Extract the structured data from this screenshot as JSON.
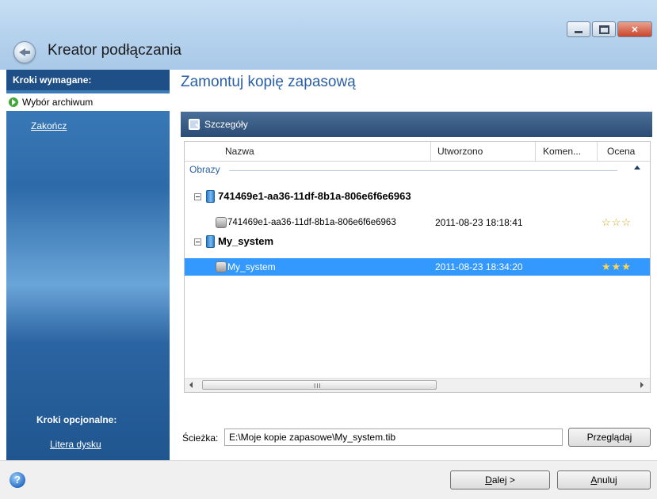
{
  "window": {
    "title": "Kreator podłączania",
    "controls": [
      "minimize-icon",
      "maximize-icon",
      "close-icon"
    ]
  },
  "sidebar": {
    "required_heading": "Kroki wymagane:",
    "steps": [
      {
        "label": "Wybór archiwum",
        "active": true
      },
      {
        "label": "Zakończ",
        "active": false
      }
    ],
    "optional_heading": "Kroki opcjonalne:",
    "optional_steps": [
      {
        "label": "Litera dysku"
      }
    ]
  },
  "main": {
    "title": "Zamontuj kopię zapasową",
    "details_label": "Szczegóły",
    "columns": [
      "Nazwa",
      "Utworzono",
      "Komen...",
      "Ocena"
    ],
    "group_label": "Obrazy",
    "tree": [
      {
        "level": 0,
        "icon": "volume-icon",
        "name": "741469e1-aa36-11df-8b1a-806e6f6e6963",
        "created": "",
        "rating": 0,
        "expanded": true
      },
      {
        "level": 1,
        "icon": "backup-disk-icon",
        "name": "741469e1-aa36-11df-8b1a-806e6f6e6963",
        "created": "2011-08-23 18:18:41",
        "rating": 3,
        "stars": "☆☆☆"
      },
      {
        "level": 0,
        "icon": "volume-icon",
        "name": "My_system",
        "created": "",
        "rating": 0,
        "expanded": true
      },
      {
        "level": 1,
        "icon": "backup-disk-icon",
        "name": "My_system",
        "created": "2011-08-23 18:34:20",
        "rating": 3,
        "stars": "★★★",
        "selected": true
      }
    ],
    "scrollbar_grip": "III",
    "path_label": "Ścieżka:",
    "path_value": "E:\\Moje kopie zapasowe\\My_system.tib",
    "browse_button": "Przeglądaj"
  },
  "footer": {
    "help": "?",
    "next_button": {
      "prefix": "",
      "underlined": "D",
      "rest": "alej >"
    },
    "cancel_button": {
      "underlined": "A",
      "rest": "nuluj"
    }
  },
  "colors": {
    "accent": "#2a5fa6",
    "selection": "#3399ff",
    "sidebar_dark": "#1e4f87"
  }
}
